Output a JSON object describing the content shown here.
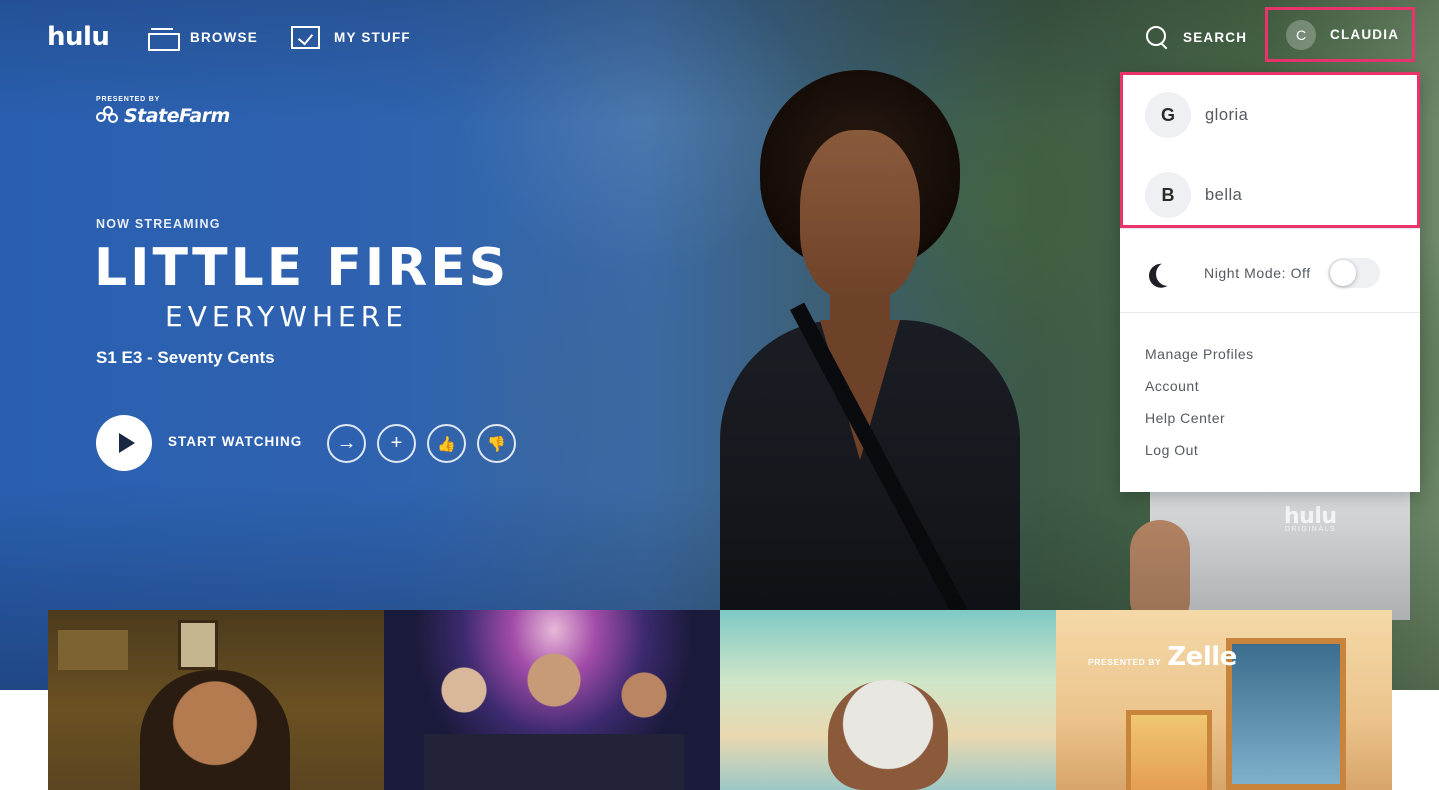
{
  "nav": {
    "logo": "hulu",
    "browse": "BROWSE",
    "my_stuff": "MY STUFF",
    "search": "SEARCH",
    "current_profile": {
      "initial": "C",
      "name": "CLAUDIA"
    }
  },
  "dropdown": {
    "profiles": [
      {
        "initial": "G",
        "name": "gloria"
      },
      {
        "initial": "B",
        "name": "bella"
      }
    ],
    "night_mode": {
      "label": "Night Mode: Off",
      "enabled": false
    },
    "links": [
      "Manage Profiles",
      "Account",
      "Help Center",
      "Log Out"
    ]
  },
  "hero": {
    "sponsor_pre": "PRESENTED BY",
    "sponsor_brand": "StateFarm",
    "eyebrow": "NOW STREAMING",
    "title_line1": "LITTLE FIRES",
    "title_line2": "EVERYWHERE",
    "episode": "S1 E3 - Seventy Cents",
    "start_label": "START WATCHING",
    "badge_logo": "hulu",
    "badge_sub": "ORIGINALS"
  },
  "tiles": [
    {
      "sponsor_pre": "",
      "sponsor_brand": ""
    },
    {
      "sponsor_pre": "",
      "sponsor_brand": ""
    },
    {
      "sponsor_pre": "",
      "sponsor_brand": ""
    },
    {
      "sponsor_pre": "PRESENTED BY",
      "sponsor_brand": "Zelle"
    }
  ],
  "colors": {
    "highlight": "#e8346a",
    "hero_blue": "#2f63b0",
    "dropdown_text": "#555a60"
  }
}
